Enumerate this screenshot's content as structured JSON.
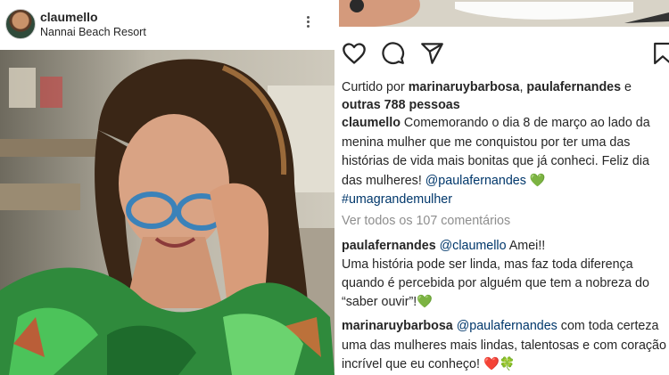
{
  "post": {
    "username": "claumello",
    "location": "Nannai Beach Resort"
  },
  "actions": {
    "icons": [
      "heart-icon",
      "comment-icon",
      "send-icon",
      "bookmark-icon"
    ]
  },
  "likes": {
    "prefix": "Curtido por ",
    "user1": "marinaruybarbosa",
    "sep": ", ",
    "user2": "paulafernandes",
    "and": " e",
    "others": "outras 788 pessoas"
  },
  "caption": {
    "username": "claumello",
    "text": " Comemorando o dia 8 de março ao lado da menina mulher que me conquistou por ter uma das histórias de vida mais bonitas que já conheci. Feliz dia das mulheres! ",
    "mention": "@paulafernandes",
    "emoji": " 💚",
    "hashtag": "#umagrandemulher"
  },
  "view_all_comments": "Ver todos os 107 comentários",
  "comments": [
    {
      "username": "paulafernandes",
      "mention": "@claumello",
      "text1": " Amei!!",
      "text2": "Uma história pode ser linda, mas faz toda diferença quando é percebida por alguém que tem a nobreza do “saber ouvir”!",
      "emoji": "💚"
    },
    {
      "username": "marinaruybarbosa",
      "mention": "@paulafernandes",
      "text": " com toda certeza uma das mulheres mais lindas, talentosas e com coração incrível que eu conheço! ",
      "emoji": "❤️🍀"
    }
  ],
  "colors": {
    "text": "#262626",
    "mention": "#00376b",
    "muted": "#8e8e8e",
    "heart_emoji": "#2e9e3e"
  }
}
